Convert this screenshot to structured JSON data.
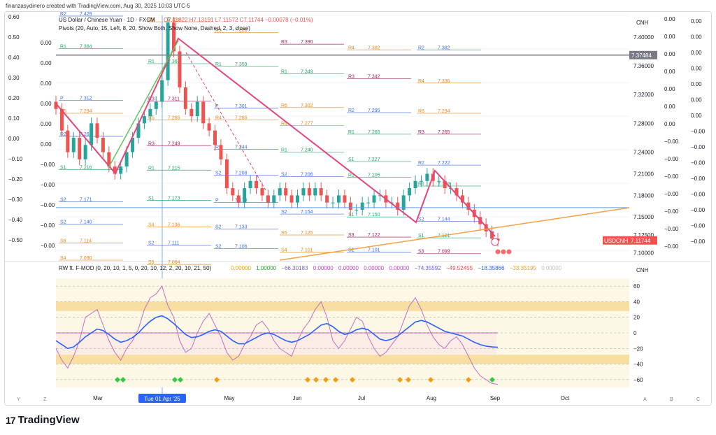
{
  "credit": "finanzasydinero created with TradingView.com, Aug 30, 2025 10:03 UTC-5",
  "brand": {
    "name": "TradingView",
    "logo_icon": "tradingview-logo-icon"
  },
  "price_pane": {
    "symbol_line": "US Dollar / Chinese Yuan · 1D · FXCM",
    "ohlc": {
      "o": "O7.11822",
      "h": "H7.13191",
      "l": "L7.11572",
      "c": "C7.11744",
      "chg": "−0.00078 (−0.01%)"
    },
    "pivots_legend": "Pivots (20, Auto, 15, Left, 8, 20, Show Both, Show None, Dashed, 2, 3, close)",
    "currency": "CNH",
    "last_price_label": "USDCNH",
    "last_price": "7.11744",
    "marked_level": "7.37484",
    "colors": {
      "up": "#26a69a",
      "down": "#ef5350",
      "trend": "#e5457a",
      "diag": "#f5a142"
    }
  },
  "indicator_pane": {
    "legend_name": "RW ft. F-MOD (0, 20, 10, 1, 5, 0, 20, 10, 12, 2, 20, 10, 21, 50)",
    "legend_values": [
      {
        "v": "0.00000",
        "c": "#f2a200"
      },
      {
        "v": "1.00000",
        "c": "#2aa52a"
      },
      {
        "v": "−66.30183",
        "c": "#7b61a8"
      },
      {
        "v": "0.00000",
        "c": "#c040c0"
      },
      {
        "v": "0.00000",
        "c": "#c040c0"
      },
      {
        "v": "0.00000",
        "c": "#c040c0"
      },
      {
        "v": "0.00000",
        "c": "#c040c0"
      },
      {
        "v": "−74.35592",
        "c": "#6a5acd"
      },
      {
        "v": "−49.52455",
        "c": "#e05050"
      },
      {
        "v": "−18.35866",
        "c": "#2962ff"
      },
      {
        "v": "−33.35195",
        "c": "#e0a030"
      },
      {
        "v": "0.00000",
        "c": "#c0c0c0"
      }
    ],
    "currency": "CNH"
  },
  "left_scale_labels": [
    "0.60",
    "0.50",
    "0.40",
    "0.30",
    "0.20",
    "0.10",
    "0.00",
    "−0.10",
    "−0.20",
    "−0.30",
    "−0.40",
    "−0.50"
  ],
  "left_scale2_labels": [
    "0.00",
    "0.00",
    "0.00",
    "0.00",
    "0.00",
    "0.00",
    "−0.00",
    "−0.00",
    "−0.00",
    "−0.00",
    "−0.00"
  ],
  "right_scale_a": [
    "0.00",
    "0.00",
    "0.00",
    "0.00",
    "0.00",
    "0.00",
    "0.00",
    "−0.00",
    "−0.00",
    "−0.00",
    "−0.00",
    "−0.00",
    "−0.00",
    "−0.00"
  ],
  "right_scale_b": [
    "0.00",
    "0.00",
    "0.00",
    "0.00",
    "0.00",
    "0.00",
    "0.00",
    "−0.00",
    "−0.00",
    "−0.00",
    "−0.00",
    "−0.00",
    "−0.00",
    "−0.00",
    "−0.00"
  ],
  "toolbar": {
    "left": [
      "Y",
      "Z"
    ],
    "right": [
      "A",
      "B",
      "C"
    ]
  },
  "time_badge": "Tue 01 Apr '25",
  "chart_data": [
    {
      "type": "candlestick",
      "title": "US Dollar / Chinese Yuan · 1D · FXCM",
      "x_ticks": [
        "Mar",
        "May",
        "Jun",
        "Jul",
        "Aug",
        "Sep",
        "Oct"
      ],
      "y_ticks": [
        "7.40000",
        "7.36000",
        "7.32000",
        "7.28000",
        "7.24000",
        "7.21000",
        "7.18000",
        "7.15000",
        "7.12500",
        "7.10000"
      ],
      "ylim": [
        7.09,
        7.43
      ],
      "close_series": [
        7.3,
        7.27,
        7.24,
        7.26,
        7.23,
        7.25,
        7.28,
        7.26,
        7.24,
        7.22,
        7.21,
        7.22,
        7.24,
        7.26,
        7.28,
        7.29,
        7.3,
        7.31,
        7.34,
        7.42,
        7.38,
        7.33,
        7.3,
        7.29,
        7.31,
        7.28,
        7.27,
        7.25,
        7.23,
        7.19,
        7.18,
        7.17,
        7.19,
        7.2,
        7.19,
        7.18,
        7.17,
        7.18,
        7.19,
        7.18,
        7.17,
        7.18,
        7.19,
        7.18,
        7.19,
        7.18,
        7.17,
        7.17,
        7.18,
        7.17,
        7.16,
        7.16,
        7.17,
        7.17,
        7.18,
        7.18,
        7.17,
        7.17,
        7.16,
        7.18,
        7.19,
        7.2,
        7.2,
        7.21,
        7.2,
        7.2,
        7.19,
        7.19,
        7.18,
        7.17,
        7.16,
        7.15,
        7.14,
        7.13,
        7.12,
        7.117
      ],
      "pivot_labels": [
        {
          "name": "R2",
          "value": "7.429"
        },
        {
          "name": "R6",
          "value": "7.421"
        },
        {
          "name": "R5",
          "value": "7.406"
        },
        {
          "name": "R3",
          "value": "7.390"
        },
        {
          "name": "R4",
          "value": "7.382"
        },
        {
          "name": "R2",
          "value": "7.382"
        },
        {
          "name": "R1",
          "value": "7.384"
        },
        {
          "name": "R1",
          "value": "7.363"
        },
        {
          "name": "R1",
          "value": "7.359"
        },
        {
          "name": "R1",
          "value": "7.349"
        },
        {
          "name": "R3",
          "value": "7.342"
        },
        {
          "name": "R4",
          "value": "7.336"
        },
        {
          "name": "P",
          "value": "7.312"
        },
        {
          "name": "R3",
          "value": "7.311"
        },
        {
          "name": "P",
          "value": "7.301"
        },
        {
          "name": "R6",
          "value": "7.302"
        },
        {
          "name": "R2",
          "value": "7.295"
        },
        {
          "name": "R6",
          "value": "7.294"
        },
        {
          "name": "R5",
          "value": "7.294"
        },
        {
          "name": "R5",
          "value": "7.285"
        },
        {
          "name": "R4",
          "value": "7.285"
        },
        {
          "name": "R4",
          "value": "7.277"
        },
        {
          "name": "R1",
          "value": "7.265"
        },
        {
          "name": "R3",
          "value": "7.265"
        },
        {
          "name": "R2",
          "value": "7.262"
        },
        {
          "name": "R3",
          "value": "7.249"
        },
        {
          "name": "R2",
          "value": "7.244"
        },
        {
          "name": "R1",
          "value": "7.240"
        },
        {
          "name": "S1",
          "value": "7.227"
        },
        {
          "name": "R2",
          "value": "7.222"
        },
        {
          "name": "S1",
          "value": "7.216"
        },
        {
          "name": "R1",
          "value": "7.215"
        },
        {
          "name": "S2",
          "value": "7.208"
        },
        {
          "name": "S2",
          "value": "7.206"
        },
        {
          "name": "R1",
          "value": "7.205"
        },
        {
          "name": "R1",
          "value": "7.193"
        },
        {
          "name": "S2",
          "value": "7.171"
        },
        {
          "name": "S1",
          "value": "7.173"
        },
        {
          "name": "P",
          "value": "7.170"
        },
        {
          "name": "S2",
          "value": "7.154"
        },
        {
          "name": "S1",
          "value": "7.150"
        },
        {
          "name": "S2",
          "value": "7.144"
        },
        {
          "name": "S2",
          "value": "7.140"
        },
        {
          "name": "S4",
          "value": "7.136"
        },
        {
          "name": "S2",
          "value": "7.133"
        },
        {
          "name": "S5",
          "value": "7.125"
        },
        {
          "name": "S3",
          "value": "7.122"
        },
        {
          "name": "S1",
          "value": "7.121"
        },
        {
          "name": "S6",
          "value": "7.114"
        },
        {
          "name": "S2",
          "value": "7.111"
        },
        {
          "name": "S2",
          "value": "7.106"
        },
        {
          "name": "S4",
          "value": "7.101"
        },
        {
          "name": "S2",
          "value": "7.101"
        },
        {
          "name": "S3",
          "value": "7.099"
        },
        {
          "name": "S4",
          "value": "7.090"
        },
        {
          "name": "S5",
          "value": "7.084"
        }
      ]
    },
    {
      "type": "line",
      "title": "RW ft. F-MOD (0, 20, 10, 1, 5, 0, 20, 10, 12, 2, 20, 10, 21, 50)",
      "y_ticks": [
        "60",
        "40",
        "20",
        "0",
        "−20",
        "−40",
        "−60"
      ],
      "ylim": [
        -70,
        70
      ],
      "bands": [
        {
          "from": 28,
          "to": 40
        },
        {
          "from": -40,
          "to": -28
        }
      ],
      "series": [
        {
          "values": [
            -20,
            -35,
            -45,
            -30,
            -10,
            20,
            25,
            30,
            10,
            -10,
            -25,
            -35,
            -20,
            -10,
            5,
            30,
            45,
            50,
            60,
            35,
            20,
            -10,
            -25,
            -20,
            0,
            15,
            25,
            10,
            -5,
            -25,
            -35,
            -30,
            -15,
            -5,
            10,
            15,
            5,
            -10,
            -20,
            -25,
            -30,
            -10,
            5,
            15,
            30,
            40,
            20,
            -10,
            -20,
            -10,
            5,
            20,
            15,
            -5,
            -20,
            -30,
            -25,
            -15,
            -5,
            15,
            35,
            45,
            30,
            10,
            -5,
            -15,
            -20,
            -10,
            -5,
            -15,
            -30,
            -45,
            -55,
            -60,
            -65,
            -66
          ]
        },
        {
          "values": [
            -10,
            -15,
            -20,
            -18,
            -12,
            -5,
            0,
            5,
            3,
            -2,
            -8,
            -12,
            -10,
            -6,
            0,
            8,
            15,
            20,
            22,
            18,
            12,
            5,
            -2,
            -6,
            -5,
            -2,
            2,
            4,
            2,
            -4,
            -10,
            -14,
            -14,
            -10,
            -6,
            -2,
            0,
            -2,
            -6,
            -10,
            -12,
            -10,
            -6,
            -2,
            4,
            10,
            12,
            8,
            2,
            -2,
            0,
            4,
            6,
            4,
            -2,
            -8,
            -10,
            -8,
            -4,
            2,
            8,
            14,
            16,
            14,
            10,
            6,
            2,
            0,
            -2,
            -4,
            -8,
            -12,
            -15,
            -17,
            -18,
            -18.4
          ]
        }
      ]
    }
  ]
}
